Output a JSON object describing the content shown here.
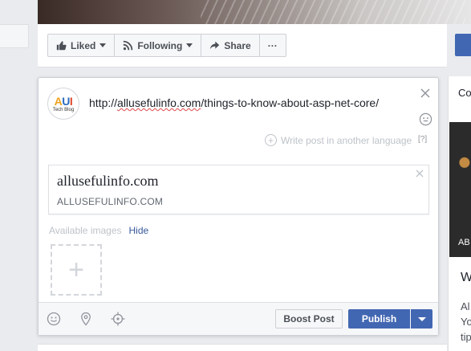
{
  "page_actions": {
    "liked_label": "Liked",
    "following_label": "Following",
    "share_label": "Share",
    "more_label": "···"
  },
  "right_panel": {
    "label": "Co",
    "image_caption": "AB",
    "heading": "W",
    "text_lines": [
      "Al",
      "Yo",
      "tip"
    ]
  },
  "composer": {
    "avatar_mark": {
      "a": "A",
      "u": "U",
      "i": "I"
    },
    "avatar_sub": "Tech Blog",
    "post_text_prefix": "http://",
    "post_text_domain": "allusefulinfo.com",
    "post_text_suffix": "/things-to-know-about-asp-net-core/",
    "write_language_label": "Write post in another language",
    "language_help": "[?]",
    "link_preview": {
      "title": "allusefulinfo.com",
      "domain": "ALLUSEFULINFO.COM"
    },
    "available_images_label": "Available images",
    "hide_label": "Hide",
    "add_image_symbol": "+",
    "boost_label": "Boost Post",
    "publish_label": "Publish"
  },
  "colors": {
    "brand_blue": "#4267b2",
    "link_blue": "#365899",
    "spellcheck_red": "#e0484a"
  },
  "icons": {
    "liked": "thumbs-up-icon",
    "following": "rss-icon",
    "share": "share-arrow-icon",
    "close": "close-icon",
    "emoji": "emoji-icon",
    "location": "location-pin-icon",
    "checkin": "crosshair-icon"
  }
}
